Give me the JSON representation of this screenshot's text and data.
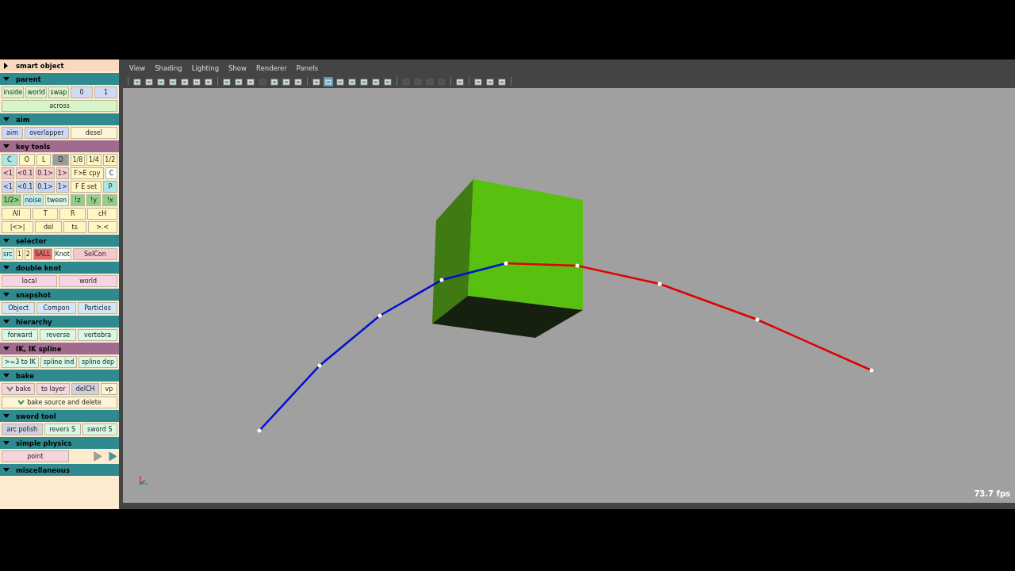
{
  "panel": {
    "sections": [
      {
        "title": "smart object",
        "color": "#fbd9c0",
        "expanded": false
      },
      {
        "title": "parent",
        "color": "#2f8a8f",
        "expanded": true,
        "rows": [
          [
            [
              {
                "kind": "button",
                "label": "inside",
                "color": "#d6f5c9"
              },
              {
                "kind": "button",
                "label": "world",
                "color": "#d6f5c9"
              },
              {
                "kind": "button",
                "label": "swap",
                "color": "#d6f5c9"
              }
            ],
            [
              {
                "kind": "button",
                "label": "0",
                "color": "#cfd9f7"
              },
              {
                "kind": "button",
                "label": "1",
                "color": "#cfd9f7"
              }
            ]
          ],
          [
            [
              {
                "kind": "button",
                "label": "across",
                "color": "#d6f5c9"
              }
            ]
          ]
        ]
      },
      {
        "title": "aim",
        "color": "#2f8a8f",
        "expanded": true,
        "rows": [
          [
            [
              {
                "kind": "button",
                "label": "aim",
                "color": "#cfd9f7"
              },
              {
                "kind": "button",
                "label": "overlapper",
                "color": "#cfd9f7"
              }
            ],
            [
              {
                "kind": "button",
                "label": "desel",
                "color": "#fff4d6"
              }
            ]
          ]
        ]
      },
      {
        "title": "key tools",
        "color": "#a06b8e",
        "expanded": true,
        "rows": [
          [
            [
              {
                "kind": "button",
                "label": "C",
                "color": "#a8e6e8"
              },
              {
                "kind": "button",
                "label": "O",
                "color": "#fff7c2"
              },
              {
                "kind": "button",
                "label": "L",
                "color": "#fff7c2"
              },
              {
                "kind": "button",
                "label": "D",
                "color": "#9c9c9c"
              }
            ],
            [
              {
                "kind": "button",
                "label": "1/8",
                "color": "#fff7c2"
              },
              {
                "kind": "button",
                "label": "1/4",
                "color": "#fff7c2"
              },
              {
                "kind": "button",
                "label": "1/2",
                "color": "#fff7c2"
              }
            ]
          ],
          [
            [
              {
                "kind": "button",
                "label": "<1",
                "color": "#f5c7cf"
              },
              {
                "kind": "button",
                "label": "<0.1",
                "color": "#f5c7cf"
              },
              {
                "kind": "button",
                "label": "0.1>",
                "color": "#f5c7cf"
              },
              {
                "kind": "button",
                "label": "1>",
                "color": "#f5c7cf"
              }
            ],
            [
              {
                "kind": "button",
                "label": "F>E cpy",
                "color": "#fff7c2"
              },
              {
                "kind": "button",
                "label": "C",
                "color": "#ffffff"
              }
            ]
          ],
          [
            [
              {
                "kind": "button",
                "label": "<1",
                "color": "#c9d5f5"
              },
              {
                "kind": "button",
                "label": "<0.1",
                "color": "#c9d5f5"
              },
              {
                "kind": "button",
                "label": "0.1>",
                "color": "#c9d5f5"
              },
              {
                "kind": "button",
                "label": "1>",
                "color": "#c9d5f5"
              }
            ],
            [
              {
                "kind": "button",
                "label": "F E set",
                "color": "#fff7c2"
              },
              {
                "kind": "button",
                "label": "P",
                "color": "#a8e6e8"
              }
            ]
          ],
          [
            [
              {
                "kind": "button",
                "label": "1/2>",
                "color": "#8fd08a"
              },
              {
                "kind": "button",
                "label": "noise",
                "color": "#b8eef0"
              },
              {
                "kind": "button",
                "label": "tween",
                "color": "#d9f8e6"
              }
            ],
            [
              {
                "kind": "button",
                "label": "!z",
                "color": "#8fd08a"
              },
              {
                "kind": "button",
                "label": "!y",
                "color": "#8fd08a"
              },
              {
                "kind": "button",
                "label": "!x",
                "color": "#8fd08a"
              }
            ]
          ],
          [
            [
              {
                "kind": "button",
                "label": "All",
                "color": "#fff7c2"
              },
              {
                "kind": "button",
                "label": "T",
                "color": "#fff7c2"
              },
              {
                "kind": "button",
                "label": "R",
                "color": "#fff7c2"
              },
              {
                "kind": "button",
                "label": "cH",
                "color": "#fff7c2"
              }
            ]
          ],
          [
            [
              {
                "kind": "button",
                "label": "|<>|",
                "color": "#fff7c2"
              },
              {
                "kind": "button",
                "label": "del",
                "color": "#fff7c2"
              },
              {
                "kind": "button",
                "label": "ts",
                "color": "#fff7c2"
              },
              {
                "kind": "button",
                "label": ">.<",
                "color": "#fff7c2"
              }
            ]
          ]
        ]
      },
      {
        "title": "selector",
        "color": "#2f8a8f",
        "expanded": true,
        "rows": [
          [
            [
              {
                "kind": "button",
                "label": "src",
                "color": "#c4f3f3"
              },
              {
                "kind": "button",
                "label": "1",
                "color": "#fff7c2"
              },
              {
                "kind": "button",
                "label": "2",
                "color": "#fff7c2"
              },
              {
                "kind": "button",
                "label": "SALL",
                "color": "#e56a6a"
              },
              {
                "kind": "button",
                "label": "Knot",
                "color": "#ffffff"
              }
            ],
            [
              {
                "kind": "button",
                "label": "SelCon",
                "color": "#f5c7cf"
              }
            ]
          ]
        ]
      },
      {
        "title": "double knot",
        "color": "#2f8a8f",
        "expanded": true,
        "rows": [
          [
            [
              {
                "kind": "button",
                "label": "local",
                "color": "#f8d3e6"
              },
              {
                "kind": "button",
                "label": "world",
                "color": "#f8d3e6"
              }
            ]
          ]
        ]
      },
      {
        "title": "snapshot",
        "color": "#2f8a8f",
        "expanded": true,
        "rows": [
          [
            [
              {
                "kind": "button",
                "label": "Object",
                "color": "#d3e6f8"
              },
              {
                "kind": "button",
                "label": "Compon",
                "color": "#d3e6f8"
              },
              {
                "kind": "button",
                "label": "Particles",
                "color": "#d3e6f8"
              }
            ]
          ]
        ]
      },
      {
        "title": "hierarchy",
        "color": "#2f8a8f",
        "expanded": true,
        "rows": [
          [
            [
              {
                "kind": "button",
                "label": "forward",
                "color": "#d9f8e6"
              },
              {
                "kind": "button",
                "label": "reverse",
                "color": "#d9f8e6"
              },
              {
                "kind": "button",
                "label": "vertebra",
                "color": "#d9f8e6"
              }
            ]
          ]
        ]
      },
      {
        "title": "IK, IK spline",
        "color": "#a06b8e",
        "expanded": true,
        "rows": [
          [
            [
              {
                "kind": "button",
                "label": ">=3 to IK",
                "color": "#d9f8e6"
              },
              {
                "kind": "button",
                "label": "spline ind",
                "color": "#d9f8e6"
              },
              {
                "kind": "button",
                "label": "spline dep",
                "color": "#d9f8e6"
              }
            ]
          ]
        ]
      },
      {
        "title": "bake",
        "color": "#2f8a8f",
        "expanded": true,
        "rows": [
          [
            [
              {
                "kind": "check_button",
                "label": "bake",
                "color": "#f8d3e0"
              },
              {
                "kind": "button",
                "label": "to layer",
                "color": "#f8d3e0"
              },
              {
                "kind": "button",
                "label": "delCH",
                "color": "#d0d0e0"
              },
              {
                "kind": "button",
                "label": "vp",
                "color": "#fff4d6"
              }
            ]
          ],
          [
            [
              {
                "kind": "check_button",
                "label": "bake source and delete",
                "color": "#fff4d6"
              }
            ]
          ]
        ]
      },
      {
        "title": "sword tool",
        "color": "#2f8a8f",
        "expanded": true,
        "rows": [
          [
            [
              {
                "kind": "button",
                "label": "arc polish",
                "color": "#d0d0e0"
              },
              {
                "kind": "button",
                "label": "revers S",
                "color": "#d9f8e6"
              },
              {
                "kind": "button",
                "label": "sword S",
                "color": "#d9f8e6"
              }
            ]
          ]
        ]
      },
      {
        "title": "simple physics",
        "color": "#2f8a8f",
        "expanded": true,
        "rows": [
          [
            [
              {
                "kind": "button",
                "label": "point",
                "color": "#f8d3e0"
              }
            ],
            [
              {
                "kind": "play",
                "color": "#a0a0a0"
              },
              {
                "kind": "play",
                "color": "#3a9aa8"
              }
            ]
          ]
        ]
      },
      {
        "title": "miscellaneous",
        "color": "#2f8a8f",
        "expanded": true
      }
    ]
  },
  "viewport": {
    "menu": [
      "View",
      "Shading",
      "Lighting",
      "Show",
      "Renderer",
      "Panels"
    ],
    "toolbar": [
      [
        {
          "selected": false,
          "disabled": false
        },
        {
          "selected": false,
          "disabled": false
        },
        {
          "selected": false,
          "disabled": false
        },
        {
          "selected": false,
          "disabled": false
        },
        {
          "selected": false,
          "disabled": false
        },
        {
          "selected": false,
          "disabled": false
        },
        {
          "selected": false,
          "disabled": false
        }
      ],
      [
        {
          "selected": false,
          "disabled": false
        },
        {
          "selected": false,
          "disabled": false
        },
        {
          "selected": false,
          "disabled": false
        },
        {
          "selected": false,
          "disabled": true
        },
        {
          "selected": false,
          "disabled": false
        },
        {
          "selected": false,
          "disabled": false
        },
        {
          "selected": false,
          "disabled": false
        }
      ],
      [
        {
          "selected": false,
          "disabled": false
        },
        {
          "selected": true,
          "disabled": false
        },
        {
          "selected": false,
          "disabled": false
        },
        {
          "selected": false,
          "disabled": false
        },
        {
          "selected": false,
          "disabled": false
        },
        {
          "selected": false,
          "disabled": false
        },
        {
          "selected": false,
          "disabled": false
        }
      ],
      [
        {
          "selected": false,
          "disabled": true
        },
        {
          "selected": false,
          "disabled": true
        },
        {
          "selected": false,
          "disabled": true
        },
        {
          "selected": false,
          "disabled": true
        }
      ],
      [
        {
          "selected": false,
          "disabled": false
        }
      ],
      [
        {
          "selected": false,
          "disabled": false
        },
        {
          "selected": false,
          "disabled": false
        },
        {
          "selected": false,
          "disabled": false
        }
      ]
    ],
    "fps": "73.7 fps"
  }
}
